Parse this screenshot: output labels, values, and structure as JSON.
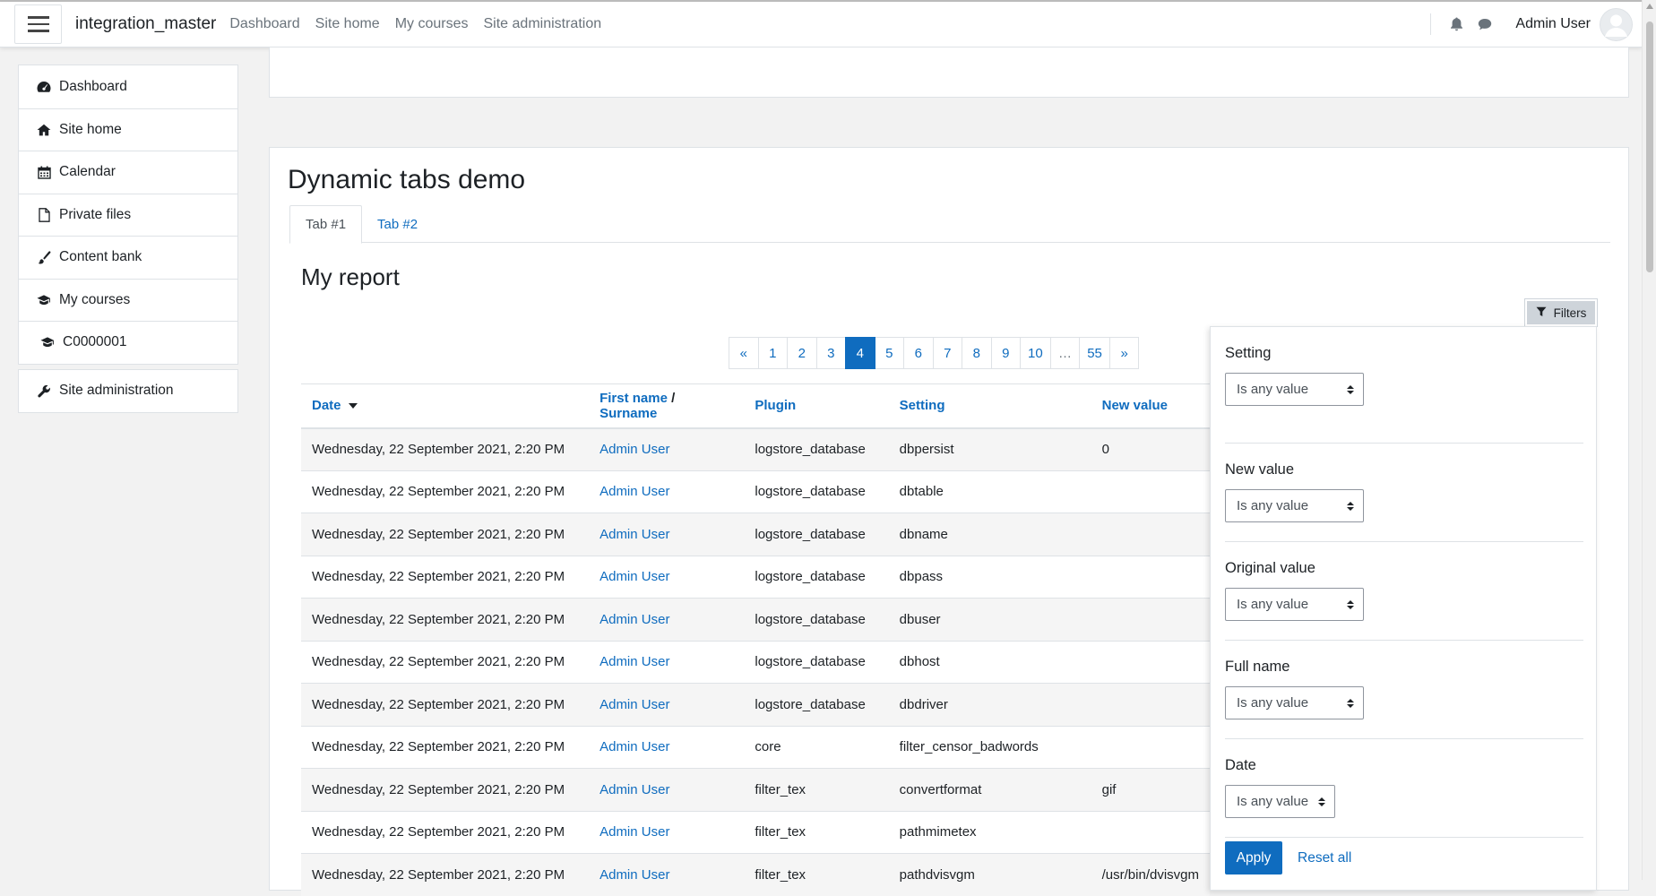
{
  "navbar": {
    "brand": "integration_master",
    "links": [
      "Dashboard",
      "Site home",
      "My courses",
      "Site administration"
    ],
    "username": "Admin User"
  },
  "sidebar": {
    "items": [
      {
        "label": "Dashboard",
        "icon": "dashboard-icon"
      },
      {
        "label": "Site home",
        "icon": "home-icon"
      },
      {
        "label": "Calendar",
        "icon": "calendar-icon"
      },
      {
        "label": "Private files",
        "icon": "file-icon"
      },
      {
        "label": "Content bank",
        "icon": "paintbrush-icon"
      },
      {
        "label": "My courses",
        "icon": "graduation-cap-icon"
      },
      {
        "label": "C0000001",
        "icon": "graduation-cap-icon"
      }
    ],
    "admin": {
      "label": "Site administration",
      "icon": "wrench-icon"
    }
  },
  "page": {
    "title": "Dynamic tabs demo",
    "tabs": [
      "Tab #1",
      "Tab #2"
    ],
    "active_tab": 0
  },
  "report": {
    "title": "My report",
    "filters_button": "Filters",
    "pagination": [
      "«",
      "1",
      "2",
      "3",
      "4",
      "5",
      "6",
      "7",
      "8",
      "9",
      "10",
      "…",
      "55",
      "»"
    ],
    "current_page": "4",
    "columns": {
      "date": "Date",
      "first_name": "First name",
      "name_sep": "/",
      "surname": "Surname",
      "plugin": "Plugin",
      "setting": "Setting",
      "new_value": "New value"
    },
    "rows": [
      {
        "date": "Wednesday, 22 September 2021, 2:20 PM",
        "user": "Admin User",
        "plugin": "logstore_database",
        "setting": "dbpersist",
        "new_value": "0"
      },
      {
        "date": "Wednesday, 22 September 2021, 2:20 PM",
        "user": "Admin User",
        "plugin": "logstore_database",
        "setting": "dbtable",
        "new_value": ""
      },
      {
        "date": "Wednesday, 22 September 2021, 2:20 PM",
        "user": "Admin User",
        "plugin": "logstore_database",
        "setting": "dbname",
        "new_value": ""
      },
      {
        "date": "Wednesday, 22 September 2021, 2:20 PM",
        "user": "Admin User",
        "plugin": "logstore_database",
        "setting": "dbpass",
        "new_value": ""
      },
      {
        "date": "Wednesday, 22 September 2021, 2:20 PM",
        "user": "Admin User",
        "plugin": "logstore_database",
        "setting": "dbuser",
        "new_value": ""
      },
      {
        "date": "Wednesday, 22 September 2021, 2:20 PM",
        "user": "Admin User",
        "plugin": "logstore_database",
        "setting": "dbhost",
        "new_value": ""
      },
      {
        "date": "Wednesday, 22 September 2021, 2:20 PM",
        "user": "Admin User",
        "plugin": "logstore_database",
        "setting": "dbdriver",
        "new_value": ""
      },
      {
        "date": "Wednesday, 22 September 2021, 2:20 PM",
        "user": "Admin User",
        "plugin": "core",
        "setting": "filter_censor_badwords",
        "new_value": ""
      },
      {
        "date": "Wednesday, 22 September 2021, 2:20 PM",
        "user": "Admin User",
        "plugin": "filter_tex",
        "setting": "convertformat",
        "new_value": "gif"
      },
      {
        "date": "Wednesday, 22 September 2021, 2:20 PM",
        "user": "Admin User",
        "plugin": "filter_tex",
        "setting": "pathmimetex",
        "new_value": ""
      },
      {
        "date": "Wednesday, 22 September 2021, 2:20 PM",
        "user": "Admin User",
        "plugin": "filter_tex",
        "setting": "pathdvisvgm",
        "new_value": "/usr/bin/dvisvgm"
      }
    ]
  },
  "filters": {
    "sections": [
      {
        "label": "Setting",
        "value": "Is any value"
      },
      {
        "label": "New value",
        "value": "Is any value"
      },
      {
        "label": "Original value",
        "value": "Is any value"
      },
      {
        "label": "Full name",
        "value": "Is any value"
      },
      {
        "label": "Date",
        "value": "Is any value"
      }
    ],
    "apply": "Apply",
    "reset": "Reset all"
  }
}
